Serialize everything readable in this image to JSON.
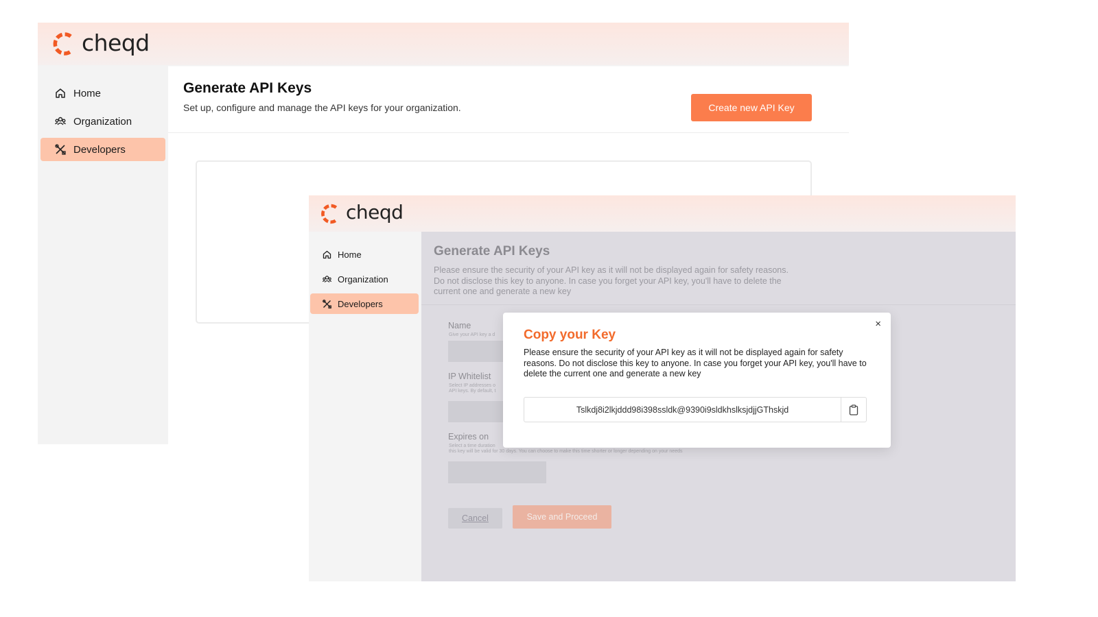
{
  "brand": {
    "name": "cheqd",
    "accent": "#fb7d4c",
    "logo_icon": "cheqd-logo-icon"
  },
  "window_a": {
    "nav": [
      {
        "label": "Home",
        "icon": "home-icon"
      },
      {
        "label": "Organization",
        "icon": "organization-icon"
      },
      {
        "label": "Developers",
        "icon": "developers-tools-icon",
        "active": true
      }
    ],
    "page_title": "Generate API Keys",
    "page_subtitle": "Set up, configure and manage the API keys for your organization.",
    "create_button": "Create new API Key"
  },
  "window_b": {
    "nav": [
      {
        "label": "Home",
        "icon": "home-icon"
      },
      {
        "label": "Organization",
        "icon": "organization-icon"
      },
      {
        "label": "Developers",
        "icon": "developers-tools-icon",
        "active": true
      }
    ],
    "page_title": "Generate API Keys",
    "page_subtitle": "Please ensure the security of your API key as it will not be displayed again for safety reasons. Do not disclose this key to anyone. In case you forget your API key, you'll have to delete the current one and generate a new key",
    "form": {
      "name_label": "Name",
      "name_hint": "Give your API key a d",
      "ip_label": "IP Whitelist",
      "ip_hint_1": "Select IP addresses o",
      "ip_hint_2": "API keys. By default, t",
      "expires_label": "Expires on",
      "expires_hint_1": "Select a time duration",
      "expires_hint_2": "this key will be valid for 30 days. You can choose to make this time shorter or longer depending on your needs",
      "cancel_label": "Cancel",
      "save_label": "Save and Proceed"
    },
    "modal": {
      "title": "Copy your Key",
      "close_glyph": "×",
      "message": "Please ensure the security of your API key as it will not be displayed again for safety reasons. Do not disclose this key to anyone. In case you forget your API key, you'll have to delete the current one and generate a new key",
      "api_key": "Tslkdj8i2lkjddd98i398ssldk@9390i9sldkhslksjdjjGThskjd",
      "copy_icon": "clipboard-icon"
    }
  }
}
